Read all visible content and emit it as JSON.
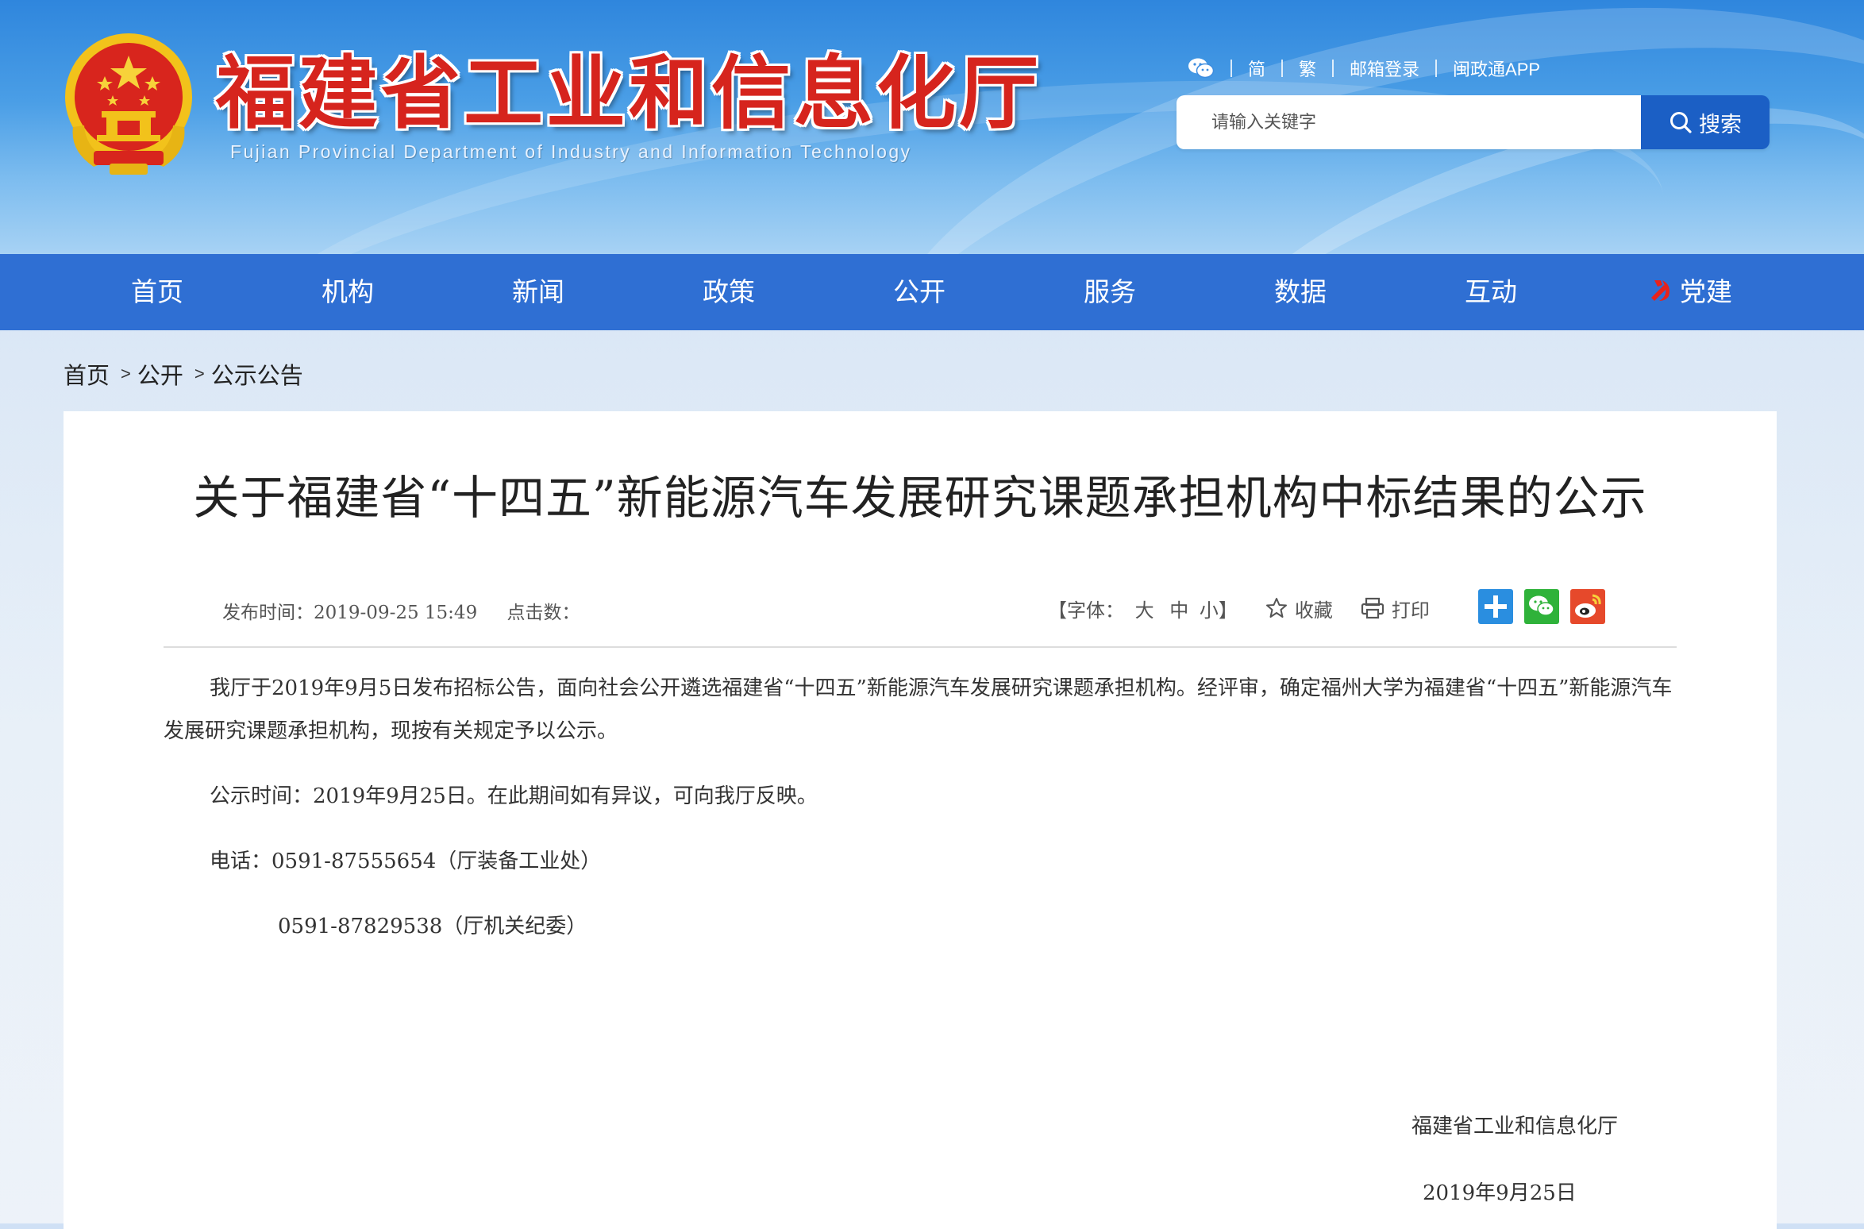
{
  "header": {
    "title": "福建省工业和信息化厅",
    "subtitle": "Fujian Provincial Department of Industry and Information Technology",
    "links": [
      "简",
      "繁",
      "邮箱登录",
      "闽政通APP"
    ],
    "search_placeholder": "请输入关键字",
    "search_button": "搜索"
  },
  "nav": {
    "items": [
      "首页",
      "机构",
      "新闻",
      "政策",
      "公开",
      "服务",
      "数据",
      "互动",
      "党建"
    ]
  },
  "breadcrumb": [
    "首页",
    "公开",
    "公示公告"
  ],
  "article": {
    "title": "关于福建省“十四五”新能源汽车发展研究课题承担机构中标结果的公示",
    "publish_label": "发布时间：",
    "publish_time": "2019-09-25 15:49",
    "clicks_label": "点击数：",
    "font_label": "【字体：",
    "font_sizes": [
      "大",
      "中",
      "小】"
    ],
    "favorite": "收藏",
    "print": "打印",
    "paragraphs": [
      "我厅于2019年9月5日发布招标公告，面向社会公开遴选福建省“十四五”新能源汽车发展研究课题承担机构。经评审，确定福州大学为福建省“十四五”新能源汽车发展研究课题承担机构，现按有关规定予以公示。",
      "公示时间：2019年9月25日。在此期间如有异议，可向我厅反映。",
      "电话：0591-87555654（厅装备工业处）",
      "0591-87829538（厅机关纪委）"
    ],
    "signoff": "福建省工业和信息化厅",
    "date": "2019年9月25日"
  },
  "colors": {
    "nav_bg": "#2f6fd3",
    "search_btn": "#1b5fc5",
    "title_red": "#d6241d"
  },
  "icons": [
    "national-emblem-icon",
    "wechat-icon",
    "search-icon",
    "party-icon",
    "star-icon",
    "printer-icon",
    "share-plus-icon",
    "share-wechat-icon",
    "share-weibo-icon"
  ]
}
